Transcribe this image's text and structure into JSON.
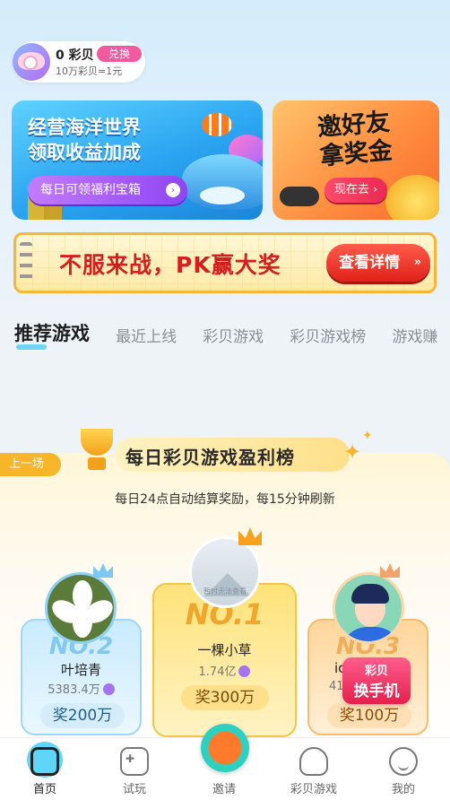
{
  "header": {
    "coin_value": "0 彩贝",
    "exchange_label": "兑换",
    "rate_text": "10万彩贝=1元"
  },
  "banners": {
    "ocean": {
      "title": "经营海洋世界\n领取收益加成",
      "button": "每日可领福利宝箱",
      "button_arrow": "›"
    },
    "invite": {
      "title": "邀好友\n拿奖金",
      "button": "现在去 ›"
    },
    "pk": {
      "title": "不服来战，PK赢大奖",
      "button": "查看详情",
      "button_arrow": "»"
    }
  },
  "tabs": [
    {
      "label": "推荐游戏",
      "active": true
    },
    {
      "label": "最近上线",
      "active": false
    },
    {
      "label": "彩贝游戏",
      "active": false
    },
    {
      "label": "彩贝游戏榜",
      "active": false
    },
    {
      "label": "游戏赚",
      "active": false
    }
  ],
  "leaderboard": {
    "prev_label": "上一场",
    "title": "每日彩贝游戏盈利榜",
    "subtitle": "每日24点自动结算奖励，每15分钟刷新",
    "avatar_placeholder": "暂时无法查看",
    "entries": [
      {
        "rank": "NO.1",
        "name": "一棵小草",
        "value": "1.74亿",
        "reward": "奖300万"
      },
      {
        "rank": "NO.2",
        "name": "叶培青",
        "value": "5383.4万",
        "reward": "奖200万"
      },
      {
        "rank": "NO.3",
        "name": "ic",
        "value": "41",
        "reward": "奖100万"
      }
    ],
    "promo": {
      "line1": "彩贝",
      "line2": "换手机"
    }
  },
  "nav": [
    {
      "label": "首页",
      "icon": "home-icon",
      "active": true
    },
    {
      "label": "试玩",
      "icon": "gamepad-icon",
      "active": false
    },
    {
      "label": "邀请",
      "icon": "invite-icon",
      "active": false
    },
    {
      "label": "彩贝游戏",
      "icon": "shell-icon",
      "active": false
    },
    {
      "label": "我的",
      "icon": "profile-icon",
      "active": false
    }
  ],
  "colors": {
    "accent_pink": "#f05aa1",
    "accent_blue": "#38c7f2",
    "gold": "#f7b52a",
    "red": "#e0211b"
  }
}
